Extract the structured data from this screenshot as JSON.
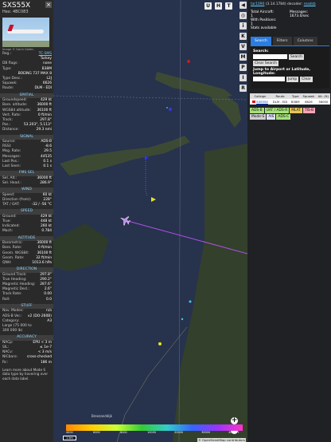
{
  "aircraft": {
    "callsign": "SXS55X",
    "hex_line": "Hex: 4BC083",
    "photo_credit": "Image © Garin Golein"
  },
  "left_rows_top": [
    {
      "k": "Reg.:",
      "v": "TC-SMS",
      "link": true
    },
    {
      "k": "",
      "v": "Turkey"
    },
    {
      "k": "DB flags:",
      "v": "none"
    },
    {
      "k": "Type:",
      "v": "B38M"
    },
    {
      "k": "",
      "v": "BOEING 737 MAX 8"
    },
    {
      "k": "Type Desc.:",
      "v": "L2J"
    },
    {
      "k": "Squawk:",
      "v": "6626"
    },
    {
      "k": "Route:",
      "v": "DLM - EDI"
    }
  ],
  "sections": [
    {
      "title": "Spatial",
      "rows": [
        {
          "k": "Groundspeed:",
          "v": "429 kt"
        },
        {
          "k": "Baro. altitude:",
          "v": "36000 ft"
        },
        {
          "k": "WGS84 altitude:",
          "v": "36100 ft"
        },
        {
          "k": "Vert. Rate:",
          "v": "0 ft/min"
        },
        {
          "k": "Track:",
          "v": "297.8°"
        },
        {
          "k": "Pos.:",
          "v": "53.203°, 5.113°"
        },
        {
          "k": "Distance:",
          "v": "29.3 nmi"
        }
      ]
    },
    {
      "title": "Signal",
      "rows": [
        {
          "k": "Source:",
          "v": "ADS-B"
        },
        {
          "k": "RSSI:",
          "v": "-8.6"
        },
        {
          "k": "Msg. Rate:",
          "v": "29.5"
        },
        {
          "k": "Messages:",
          "v": "44535"
        },
        {
          "k": "",
          "v": ""
        },
        {
          "k": "Last Pos.:",
          "v": "0.1 s"
        },
        {
          "k": "Last Seen:",
          "v": "0.1 s"
        }
      ]
    },
    {
      "title": "FMS Sel",
      "rows": [
        {
          "k": "Sel. Alt.:",
          "v": "36000 ft"
        },
        {
          "k": "Sel. Head.:",
          "v": "286.9°"
        }
      ]
    },
    {
      "title": "Wind",
      "rows": [
        {
          "k": "Speed:",
          "v": "60 kt"
        },
        {
          "k": "Direction (from):",
          "v": "228°"
        },
        {
          "k": "TAT / OAT:",
          "v": "-32 / -56 °C"
        }
      ]
    },
    {
      "title": "Speed",
      "rows": [
        {
          "k": "Ground:",
          "v": "429 kt"
        },
        {
          "k": "True:",
          "v": "448 kt"
        },
        {
          "k": "Indicated:",
          "v": "260 kt"
        },
        {
          "k": "Mach:",
          "v": "0.784"
        }
      ]
    },
    {
      "title": "Altitude",
      "rows": [
        {
          "k": "Barometric:",
          "v": "36000 ft"
        },
        {
          "k": "Baro. Rate:",
          "v": "0 ft/min"
        },
        {
          "k": "Geom. WGS84:",
          "v": "36100 ft"
        },
        {
          "k": "Geom. Rate:",
          "v": "32 ft/min"
        },
        {
          "k": "QNH:",
          "v": "1013.6 hPa"
        }
      ]
    },
    {
      "title": "Direction",
      "rows": [
        {
          "k": "Ground Track:",
          "v": "297.8°"
        },
        {
          "k": "True Heading:",
          "v": "290.2°"
        },
        {
          "k": "Magnetic Heading:",
          "v": "287.6°"
        },
        {
          "k": "Magnetic Decl.:",
          "v": "2.6°"
        },
        {
          "k": "Track Rate:",
          "v": "0.00"
        },
        {
          "k": "Roll:",
          "v": "0.0"
        }
      ]
    },
    {
      "title": "Stuff",
      "rows": [
        {
          "k": "Nav. Modes:",
          "v": "n/a"
        },
        {
          "k": "ADS-B Ver.:",
          "v": "v2 (DO-260B)"
        },
        {
          "k": "Category:",
          "v": "A3"
        },
        {
          "k": "Large (75 000 to",
          "v": ""
        },
        {
          "k": "300 000 lb)",
          "v": ""
        }
      ]
    },
    {
      "title": "Accuracy",
      "rows": [
        {
          "k": "NACp:",
          "v": "EPU < 3 m"
        },
        {
          "k": "SIL:",
          "v": "≤ 1e-7"
        },
        {
          "k": "NACv:",
          "v": "< 3 m/s"
        },
        {
          "k": "NICbaro:",
          "v": "cross-checked"
        },
        {
          "k": "Rc:",
          "v": "186 m"
        }
      ]
    }
  ],
  "learn_more": "Learn more about Mode S data type by hovering over each data label.",
  "map": {
    "top_buttons": [
      "U",
      "H",
      "T"
    ],
    "zoom_in": "+",
    "zoom_out": "−",
    "attribution": "© OpenStreetMap contributors",
    "scale_labels": [
      "4000",
      "6000",
      "8000",
      "10000",
      "20000",
      "30000",
      "40000+"
    ],
    "scale_box": "1 km",
    "place_label": "Breezanddijk"
  },
  "side_buttons": [
    "◀",
    "◎",
    "i",
    "K",
    "V",
    "M",
    "P",
    "I",
    "R"
  ],
  "right": {
    "header_link": "tar1090",
    "header_rest": "(3.14.1784) decoder:",
    "header_link2": "readsb",
    "stats": [
      {
        "label": "Total Aircraft:",
        "value": "1"
      },
      {
        "label": "Messages:",
        "value": "1673.0/sec"
      },
      {
        "label": "With Positions:",
        "value": "1"
      },
      {
        "label": "Stats available",
        "value": ""
      }
    ],
    "tabs": [
      "Search",
      "Filters",
      "Columns"
    ],
    "search_label": "Search:",
    "search_button": "Search",
    "clear_search": "Clear Search",
    "jump_label": "Jump to Airport or Latitude, Longitude:",
    "jump_button": "Jump",
    "clear_button": "Clear",
    "columns": [
      "Callsign",
      "Route",
      "Type",
      "Squawk",
      "Alt. (ft)"
    ],
    "rows": [
      {
        "callsign": "SXS55X",
        "route": "DLM - EDI",
        "type": "B38M",
        "squawk": "6626",
        "alt": "36000"
      }
    ],
    "legend": [
      {
        "label": "ADS-B",
        "color": "#a6e07a"
      },
      {
        "label": "UAT / ADS-R",
        "color": "#a6e07a"
      },
      {
        "label": "MLAT",
        "color": "#e8c45a"
      },
      {
        "label": "TIS-B",
        "color": "#f4a6b6"
      },
      {
        "label": "Mode-S",
        "color": "#cfcfcf"
      },
      {
        "label": "AIS",
        "color": "#e0e0ff"
      },
      {
        "label": "ADS-C",
        "color": "#a6e07a"
      }
    ]
  }
}
